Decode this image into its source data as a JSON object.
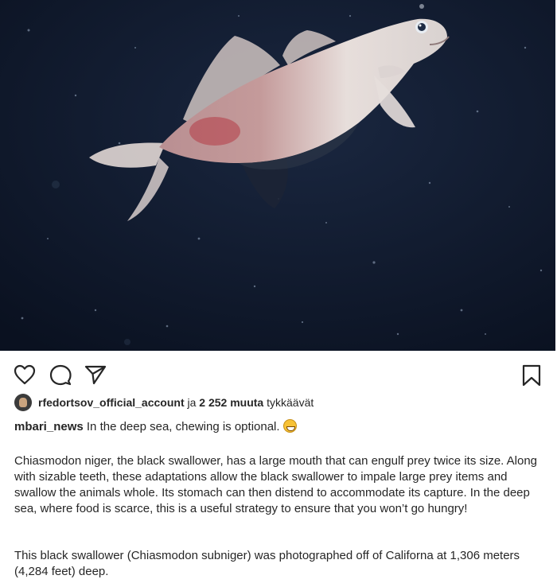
{
  "post": {
    "image_alt": "Black swallower fish photographed in the deep sea",
    "likes": {
      "user": "rfedortsov_official_account",
      "connector": " ja ",
      "count": "2 252 muuta",
      "suffix": " tykkäävät"
    },
    "caption": {
      "author": "mbari_news",
      "text": " In the deep sea, chewing is optional."
    },
    "body_paragraph_1": "Chiasmodon niger, the black swallower, has a large mouth that can engulf prey twice its size. Along with sizable teeth, these adaptations allow the black swallower to impale large prey items and swallow the animals whole. Its stomach can then distend to accommodate its capture. In the deep sea, where food is scarce, this is a useful strategy to ensure that you won’t go hungry!",
    "body_paragraph_2": "This black swallower (Chiasmodon subniger) was photographed off of Californa at 1,306 meters (4,284 feet) deep."
  },
  "icons": {
    "like": "heart-icon",
    "comment": "comment-bubble-icon",
    "share": "paper-plane-icon",
    "save": "bookmark-icon"
  },
  "colors": {
    "text": "#262626",
    "background": "#ffffff",
    "photo_background": "#0f1a2c"
  }
}
